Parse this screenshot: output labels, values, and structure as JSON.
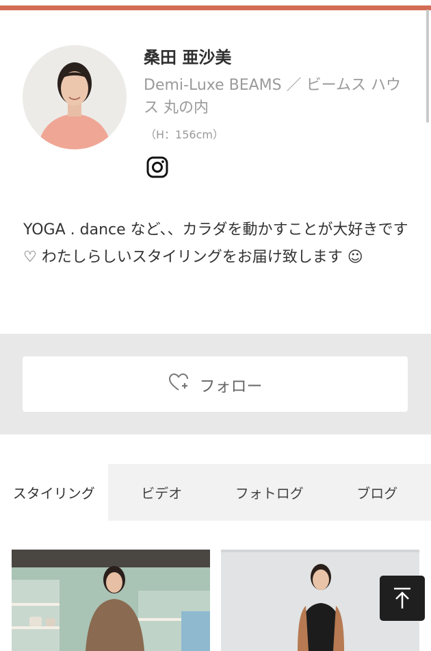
{
  "profile": {
    "name": "桑田 亜沙美",
    "shop": "Demi-Luxe BEAMS ／ ビームス ハウス 丸の内",
    "height": "（H：156cm）",
    "social_icon": "instagram-icon",
    "bio": "YOGA . dance など、、カラダを動かすことが大好きです ♡ わたしらしいスタイリングをお届け致します ☺"
  },
  "follow": {
    "label": "フォロー",
    "icon": "heart-plus-icon"
  },
  "tabs": [
    {
      "label": "スタイリング",
      "active": true
    },
    {
      "label": "ビデオ",
      "active": false
    },
    {
      "label": "フォトログ",
      "active": false
    },
    {
      "label": "ブログ",
      "active": false
    }
  ],
  "back_to_top_icon": "arrow-up-icon",
  "colors": {
    "accent": "#d36c54",
    "follow_background": "#e8e8e8",
    "tab_background": "#f2f2f2",
    "back_to_top": "#1f1f1f"
  }
}
